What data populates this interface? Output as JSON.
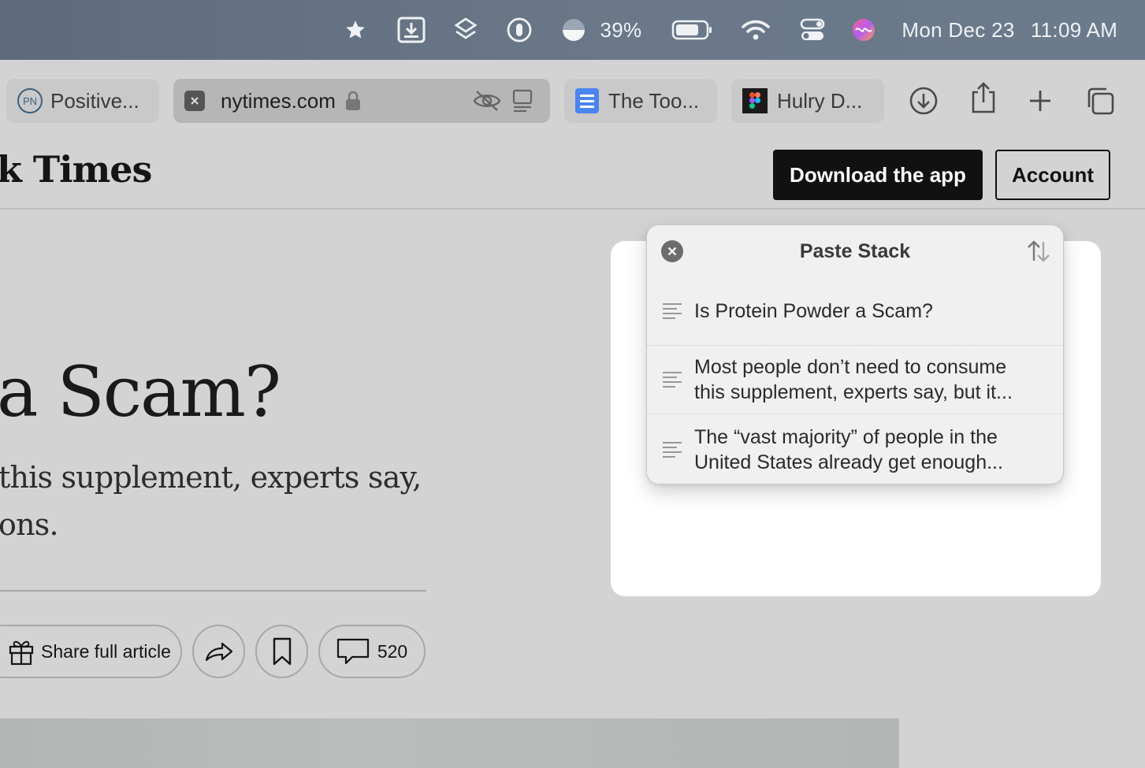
{
  "menubar": {
    "battery_percent": "39%",
    "date": "Mon Dec 23",
    "time": "11:09 AM",
    "icons": [
      "star-icon",
      "download-box-icon",
      "layers-icon",
      "password-icon",
      "half-circle-icon",
      "battery-icon",
      "wifi-icon",
      "control-center-icon",
      "siri-icon"
    ]
  },
  "tabs": [
    {
      "label": "Positive...",
      "favicon": "PN"
    },
    {
      "label": "nytimes.com",
      "active": true
    },
    {
      "label": "The Too..."
    },
    {
      "label": "Hulry D..."
    }
  ],
  "site": {
    "logo": "k Times",
    "download_button": "Download the app",
    "account_button": "Account"
  },
  "article": {
    "headline": "a Scam?",
    "summary_line1": "this supplement, experts say,",
    "summary_line2": "ons.",
    "share_label": "Share full article",
    "comment_count": "520"
  },
  "paste_stack": {
    "title": "Paste Stack",
    "items": [
      {
        "line1": "Is Protein Powder a Scam?",
        "line2": ""
      },
      {
        "line1": "Most people don’t need to consume",
        "line2": "this supplement, experts say, but it..."
      },
      {
        "line1": "The “vast majority” of people in the",
        "line2": "United States already get enough..."
      }
    ]
  }
}
